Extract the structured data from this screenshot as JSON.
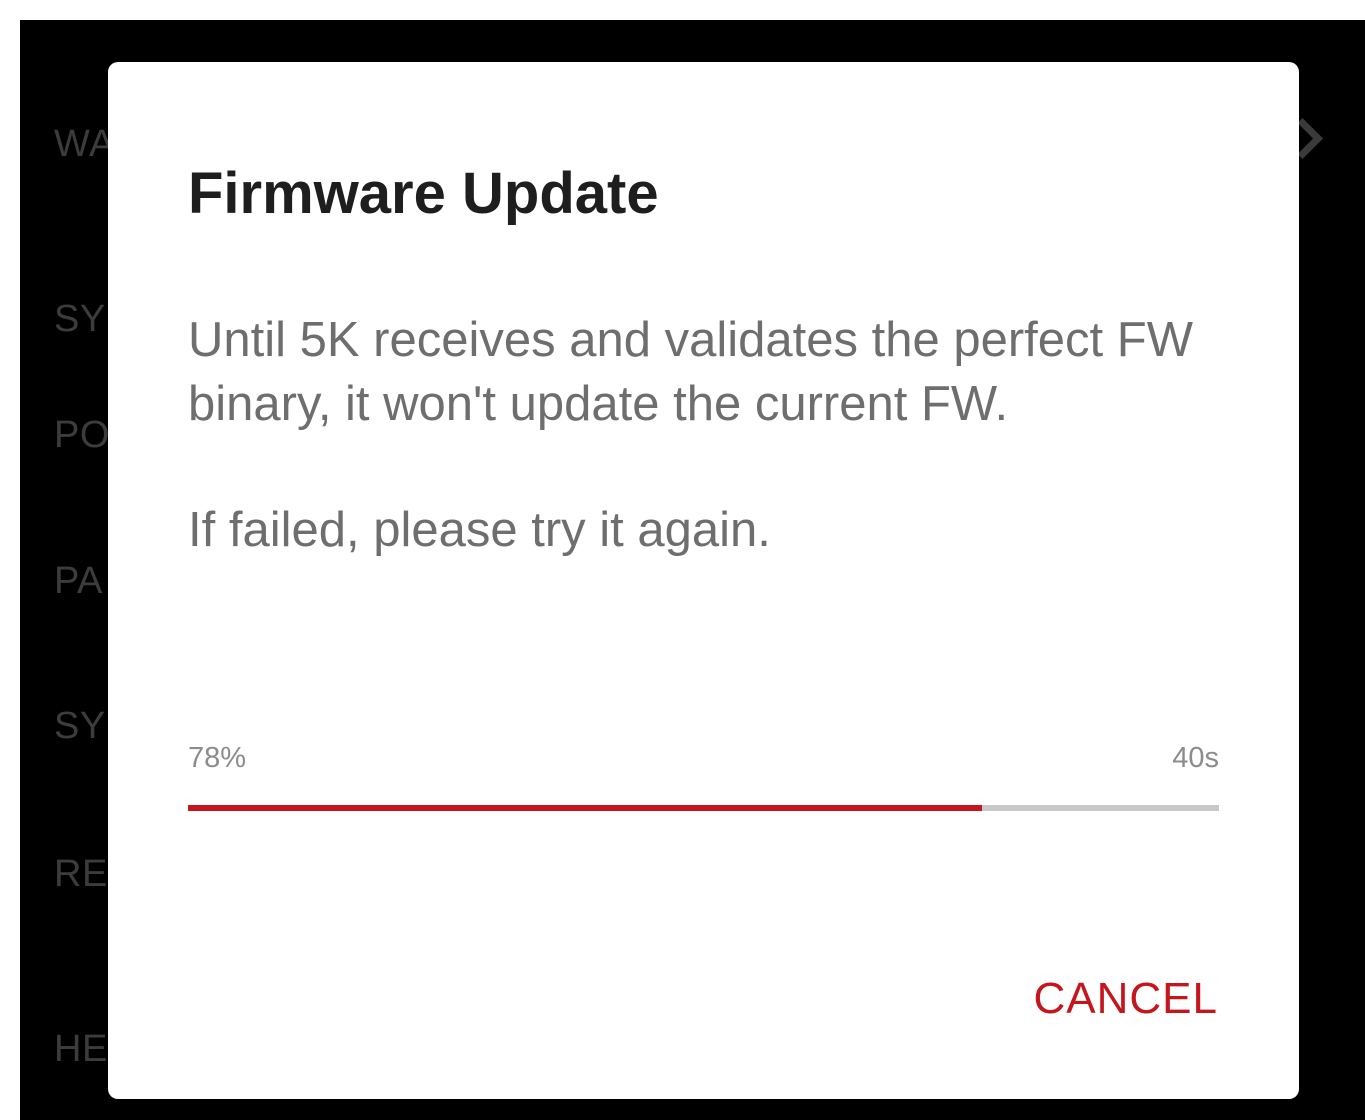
{
  "background": {
    "items": [
      "WA",
      "SY",
      "PO",
      "PA",
      "SY",
      "RE",
      "HE"
    ]
  },
  "dialog": {
    "title": "Firmware Update",
    "message_line1": "Until 5K receives and validates the perfect FW binary, it won't update the current FW.",
    "message_line2": "If failed, please try it again.",
    "progress": {
      "percent_label": "78%",
      "fraction": 0.77,
      "time_label": "40s",
      "fill_color": "#c4161c"
    },
    "cancel_label": "CANCEL",
    "accent_color": "#c4161c"
  }
}
